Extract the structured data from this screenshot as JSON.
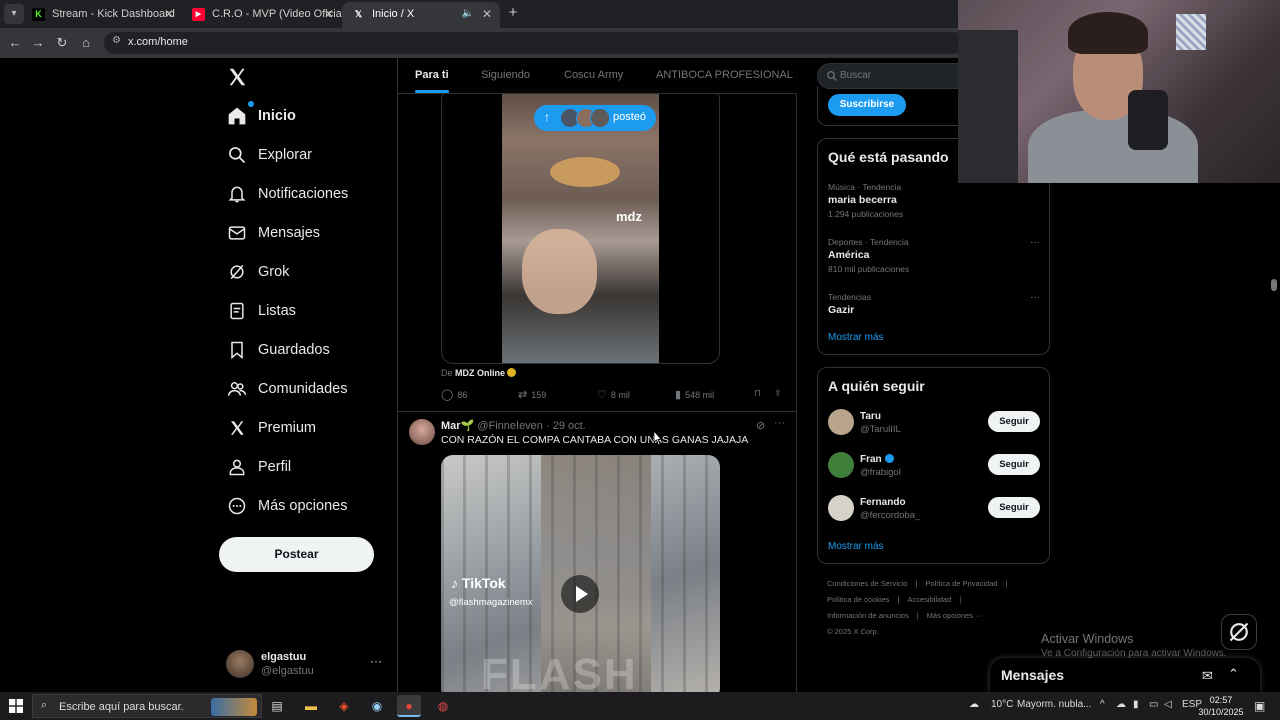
{
  "browser": {
    "tabs": [
      {
        "title": "Stream - Kick Dashboard",
        "favicon": "kick-icon",
        "color": "#53fc18"
      },
      {
        "title": "C.R.O - MVP (Video Oficial) - Yo",
        "favicon": "youtube-icon",
        "color": "#ff0033"
      },
      {
        "title": "Inicio / X",
        "favicon": "x-icon",
        "color": "#ffffff",
        "active": true
      }
    ],
    "url": "x.com/home"
  },
  "nav": {
    "items": [
      {
        "label": "Inicio",
        "icon": "home-icon",
        "active": true
      },
      {
        "label": "Explorar",
        "icon": "search-icon"
      },
      {
        "label": "Notificaciones",
        "icon": "bell-icon"
      },
      {
        "label": "Mensajes",
        "icon": "mail-icon"
      },
      {
        "label": "Grok",
        "icon": "grok-icon"
      },
      {
        "label": "Listas",
        "icon": "list-icon"
      },
      {
        "label": "Guardados",
        "icon": "bookmark-icon"
      },
      {
        "label": "Comunidades",
        "icon": "people-icon"
      },
      {
        "label": "Premium",
        "icon": "x-icon"
      },
      {
        "label": "Perfil",
        "icon": "person-icon"
      },
      {
        "label": "Más opciones",
        "icon": "more-circle-icon"
      }
    ],
    "post_label": "Postear",
    "account": {
      "name": "elgastuu",
      "handle": "@elgastuu",
      "more": "···"
    }
  },
  "feed": {
    "tabs": [
      "Para ti",
      "Siguiendo",
      "Coscu Army",
      "ANTIBOCA PROFESIONAL"
    ],
    "new_posts_pill": "posteó",
    "tweet1": {
      "video_watermark": "mdz",
      "from_prefix": "De",
      "from_name": "MDZ Online",
      "replies": "86",
      "reposts": "159",
      "likes": "8 mil",
      "views": "548 mil"
    },
    "tweet2": {
      "name": "Mar🌱",
      "handle": "@FinneIeven",
      "sep": "·",
      "date": "29 oct.",
      "text": "CON RAZÓN EL COMPA CANTABA CON UNAS GANAS JAJAJA",
      "media_brand": "TikTok",
      "media_handle": "@flashmagazinemx",
      "media_watermark": "FLASH"
    }
  },
  "sidebar": {
    "search_placeholder": "Buscar",
    "subscribe_label": "Suscribirse",
    "trends_title": "Qué está pasando",
    "trends": [
      {
        "context": "Música · Tendencia",
        "name": "maria becerra",
        "posts": "1.294 publicaciones",
        "more": ""
      },
      {
        "context": "Deportes · Tendencia",
        "name": "América",
        "posts": "810 mil publicaciones",
        "more": "···"
      },
      {
        "context": "Tendencias",
        "name": "Gazir",
        "posts": "",
        "more": "···"
      }
    ],
    "trends_more": "Mostrar más",
    "who_title": "A quién seguir",
    "who": [
      {
        "name": "Taru",
        "handle": "@TarulIIL",
        "verified": false,
        "button": "Seguir",
        "color": "#b9a48e"
      },
      {
        "name": "Fran",
        "handle": "@frabigol",
        "verified": true,
        "button": "Seguir",
        "color": "#3f7f3a"
      },
      {
        "name": "Fernando",
        "handle": "@fercordoba_",
        "verified": false,
        "button": "Seguir",
        "color": "#d6d2c8"
      }
    ],
    "who_more": "Mostrar más",
    "footer": [
      "Condiciones de Servicio",
      "|",
      "Política de Privacidad",
      "|",
      "Política de cookies",
      "|",
      "Accesibilidad",
      "|",
      "Información de anuncios",
      "|",
      "Más opciones ···",
      "© 2025 X Corp."
    ]
  },
  "overlay": {
    "activate_title": "Activar Windows",
    "activate_sub": "Ve a Configuración para activar Windows.",
    "messages_label": "Mensajes"
  },
  "taskbar": {
    "search_placeholder": "Escribe aquí para buscar.",
    "weather": "10°C",
    "weather_text": "Mayorm. nubla...",
    "lang": "ESP",
    "time": "02:57",
    "date": "30/10/2025"
  }
}
